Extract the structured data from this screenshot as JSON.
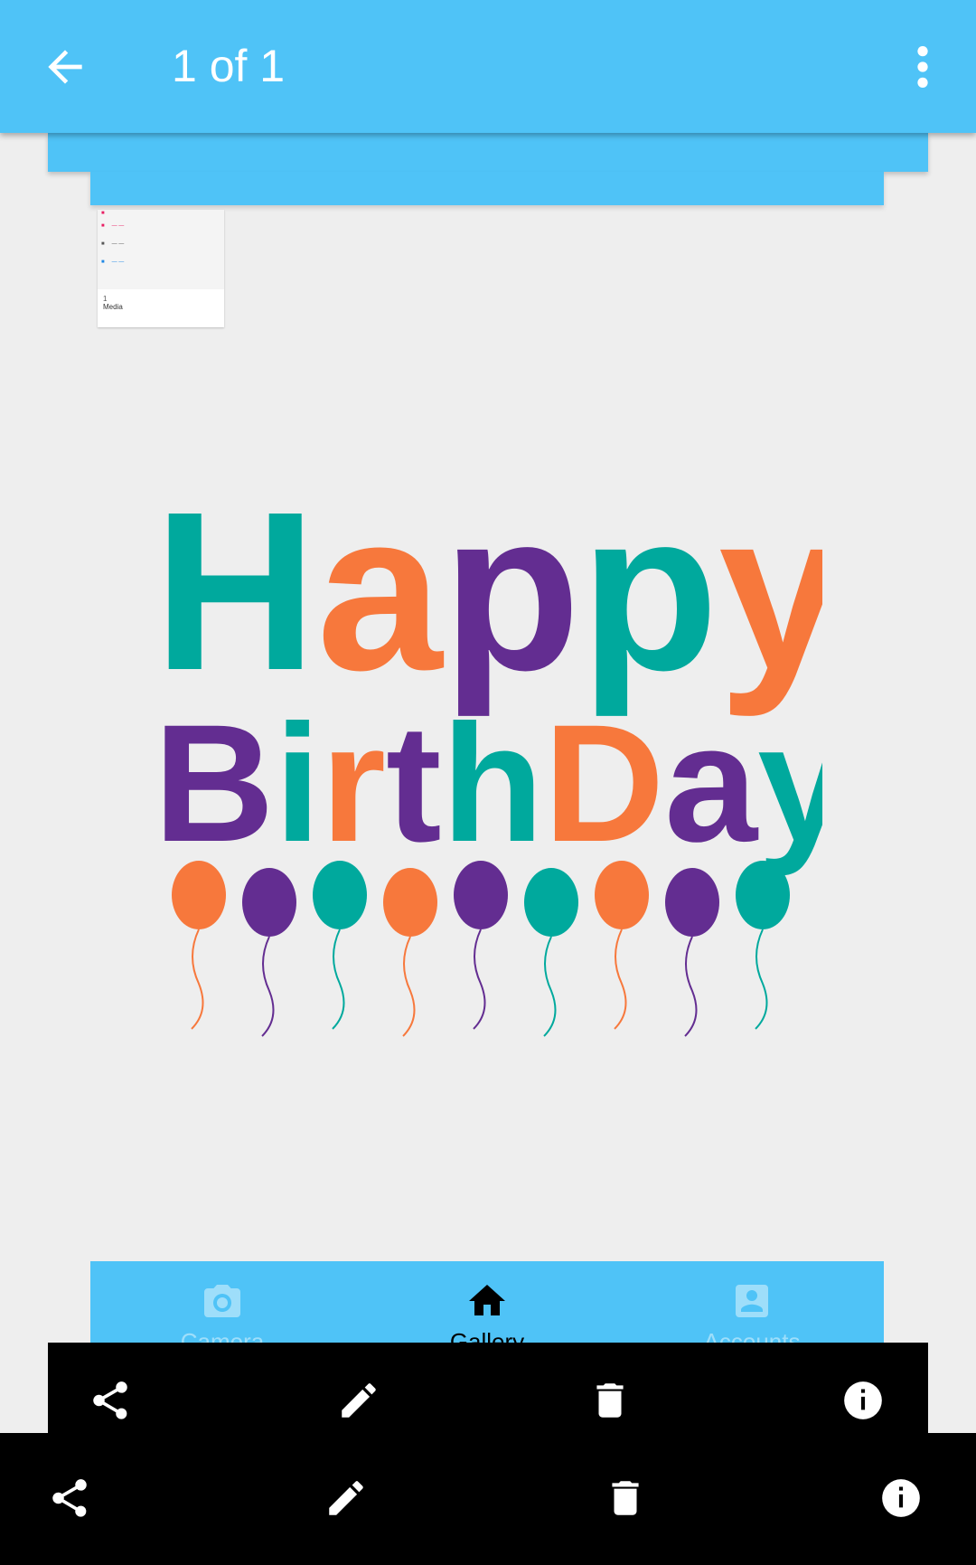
{
  "appbar": {
    "title": "1 of 1",
    "back_icon": "arrow-back-icon",
    "more_icon": "more-vert-icon"
  },
  "thumbnail": {
    "footer_count": "1",
    "footer_label": "Media"
  },
  "artwork": {
    "line1": "Happy",
    "line2": "Birthday",
    "colors": {
      "teal": "#00a99d",
      "orange": "#f7783c",
      "purple": "#632d91"
    }
  },
  "bottom_nav": {
    "items": [
      {
        "label": "Camera",
        "icon": "camera-icon"
      },
      {
        "label": "Gallery",
        "icon": "home-icon"
      },
      {
        "label": "Accounts",
        "icon": "account-box-icon"
      }
    ]
  },
  "actions": [
    {
      "label": "Share",
      "icon": "share-icon"
    },
    {
      "label": "Edit",
      "icon": "edit-icon"
    },
    {
      "label": "Delete",
      "icon": "delete-icon"
    },
    {
      "label": "Info",
      "icon": "info-icon"
    }
  ],
  "colors": {
    "accent": "#4fc3f7",
    "background": "#eeeeee"
  }
}
